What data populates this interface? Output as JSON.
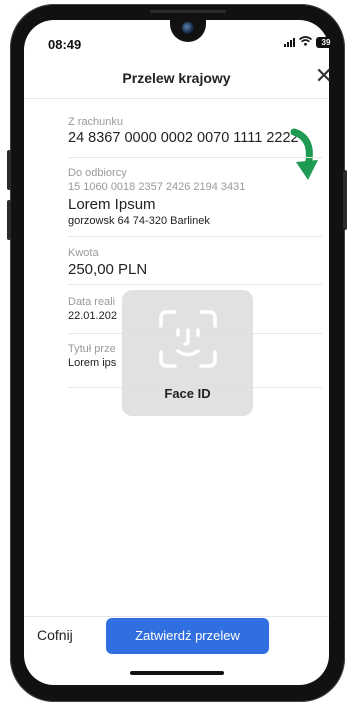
{
  "status_bar": {
    "time": "08:49",
    "battery": "39"
  },
  "header": {
    "title": "Przelew krajowy",
    "close_symbol": "✕"
  },
  "from_account": {
    "label": "Z rachunku",
    "number": "24 8367 0000 0002 0070 1111 2222"
  },
  "recipient": {
    "label": "Do odbiorcy",
    "account": "15 1060 0018 2357 2426 2194 3431",
    "name": "Lorem Ipsum",
    "address": "gorzowsk 64 74-320 Barlinek"
  },
  "amount": {
    "label": "Kwota",
    "value": "250,00 PLN"
  },
  "date": {
    "label": "Data reali",
    "value": "22.01.202"
  },
  "title_field": {
    "label": "Tytuł prze",
    "value": "Lorem ips"
  },
  "face_id": {
    "label": "Face ID"
  },
  "footer": {
    "back_label": "Cofnij",
    "confirm_label": "Zatwierdź przelew"
  },
  "colors": {
    "accent": "#2f6fe0",
    "arrow": "#1e9a52"
  }
}
